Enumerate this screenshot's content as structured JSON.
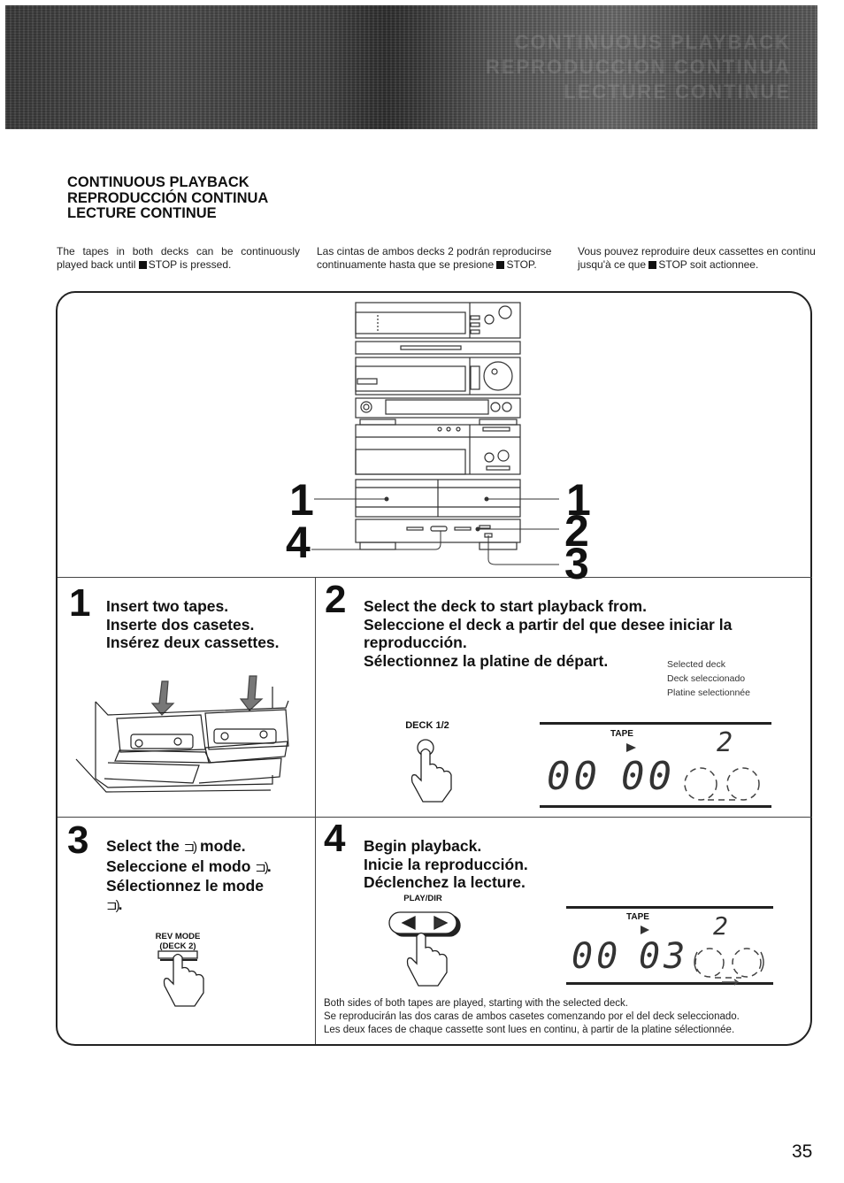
{
  "header": {
    "banner_ghost_lines": [
      "CONTINUOUS PLAYBACK",
      "REPRODUCCION CONTINUA",
      "LECTURE CONTINUE"
    ]
  },
  "section": {
    "titles": [
      "CONTINUOUS PLAYBACK",
      "REPRODUCCIÓN CONTINUA",
      "LECTURE CONTINUE"
    ]
  },
  "intro": {
    "en": {
      "before_stop": "The tapes in both decks can be continuously played back until",
      "after_stop": "STOP is pressed."
    },
    "es": {
      "before_stop": "Las cintas de ambos decks 2 podrán reproducirse continuamente hasta que se presione",
      "after_stop": "STOP."
    },
    "fr": {
      "before_stop": "Vous pouvez reproduire deux cassettes en continu jusqu'à ce que",
      "after_stop": "STOP soit actionnee."
    }
  },
  "overview_diagram": {
    "callouts_left": [
      "1",
      "4"
    ],
    "callouts_right": [
      "1",
      "2",
      "3"
    ]
  },
  "steps": [
    {
      "number": "1",
      "lines": [
        "Insert two tapes.",
        "Inserte dos casetes.",
        "Insérez deux cassettes."
      ],
      "illustration": "two-cassettes-inserted"
    },
    {
      "number": "2",
      "lines": [
        "Select the deck to start playback from.",
        "Seleccione el deck a partir del que desee iniciar la",
        "reproducción.",
        "Sélectionnez la platine de départ."
      ],
      "button_label": "DECK 1/2",
      "caption": [
        "Selected deck",
        "Deck seleccionado",
        "Platine selectionnée"
      ],
      "display": {
        "label": "TAPE",
        "counter_left": "00",
        "counter_right": "00",
        "deck": "2"
      }
    },
    {
      "number": "3",
      "line1_before": "Select the",
      "line1_after": "mode.",
      "line2_before": "Seleccione el modo",
      "line2_after": ".",
      "line3": "Sélectionnez le mode",
      "line4_after": ".",
      "mode_symbol": "⊐)",
      "button_label_1": "REV MODE",
      "button_label_2": "(DECK 2)"
    },
    {
      "number": "4",
      "lines": [
        "Begin playback.",
        "Inicie la reproducción.",
        "Déclenchez la lecture."
      ],
      "button_label": "PLAY/DIR",
      "display": {
        "label": "TAPE",
        "counter_left": "00",
        "counter_right": "03",
        "deck": "2"
      }
    }
  ],
  "note": [
    "Both sides of both tapes are played, starting with the selected deck.",
    "Se reproducirán las dos caras de ambos casetes comenzando por el del deck seleccionado.",
    "Les deux faces de chaque cassette sont lues en continu, à partir de la platine sélectionnée."
  ],
  "page_number": "35"
}
